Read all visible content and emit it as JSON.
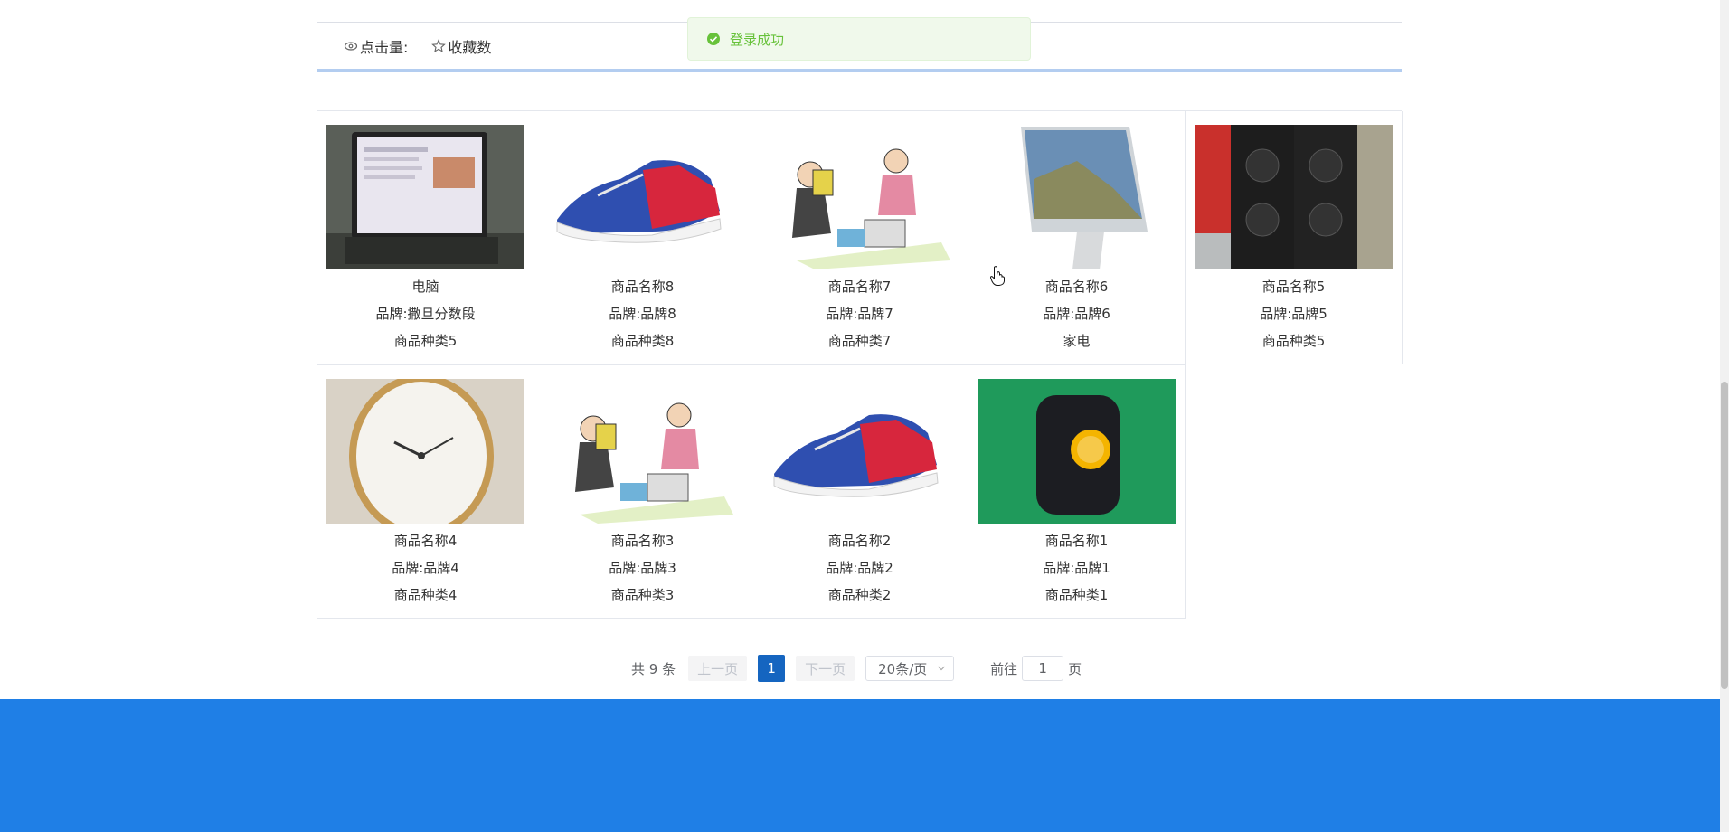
{
  "stats": {
    "clicks_label": "点击量:",
    "favorites_label": "收藏数"
  },
  "toast": {
    "message": "登录成功",
    "icon": "check-circle-icon"
  },
  "products": [
    {
      "name": "电脑",
      "brand": "品牌:撒旦分数段",
      "category": "商品种类5",
      "image": "laptop-photo"
    },
    {
      "name": "商品名称8",
      "brand": "品牌:品牌8",
      "category": "商品种类8",
      "image": "sneaker-photo"
    },
    {
      "name": "商品名称7",
      "brand": "品牌:品牌7",
      "category": "商品种类7",
      "image": "cartoon-kids-illustration"
    },
    {
      "name": "商品名称6",
      "brand": "品牌:品牌6",
      "category": "家电",
      "image": "imac-photo"
    },
    {
      "name": "商品名称5",
      "brand": "品牌:品牌5",
      "category": "商品种类5",
      "image": "speakers-photo"
    },
    {
      "name": "商品名称4",
      "brand": "品牌:品牌4",
      "category": "商品种类4",
      "image": "watch-photo"
    },
    {
      "name": "商品名称3",
      "brand": "品牌:品牌3",
      "category": "商品种类3",
      "image": "cartoon-kids-illustration"
    },
    {
      "name": "商品名称2",
      "brand": "品牌:品牌2",
      "category": "商品种类2",
      "image": "sneaker-photo"
    },
    {
      "name": "商品名称1",
      "brand": "品牌:品牌1",
      "category": "商品种类1",
      "image": "phone-photo"
    }
  ],
  "pagination": {
    "total": "共 9 条",
    "prev": "上一页",
    "current": "1",
    "next": "下一页",
    "page_size": "20条/页",
    "goto_prefix": "前往",
    "goto_value": "1",
    "goto_suffix": "页"
  },
  "colors": {
    "accent": "#1565c0",
    "footer": "#1f7fe6",
    "toast_text": "#67c23a",
    "toast_bg": "#f0f9eb"
  }
}
